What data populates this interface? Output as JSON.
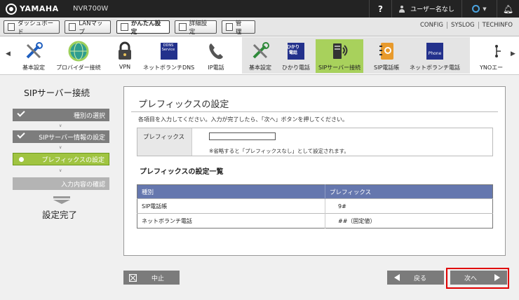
{
  "header": {
    "brand": "YAMAHA",
    "model": "NVR700W",
    "help": "?",
    "user_label": "ユーザー名なし"
  },
  "tabs": [
    {
      "label": "ダッシュボード"
    },
    {
      "label": "LANマップ"
    },
    {
      "label": "かんたん設定",
      "active": true
    },
    {
      "label": "詳細設定"
    },
    {
      "label": "管　理"
    }
  ],
  "links": [
    "CONFIG",
    "SYSLOG",
    "TECHINFO"
  ],
  "icon_bar": {
    "items": [
      {
        "label": "基本設定",
        "icon": "tools-icon"
      },
      {
        "label": "プロバイダー接続",
        "icon": "globe-icon"
      },
      {
        "label": "VPN",
        "icon": "lock-icon"
      },
      {
        "label": "ネットボランチDNS",
        "icon": "dns-icon",
        "badge": "DDNS Service"
      },
      {
        "label": "IP電話",
        "icon": "phone-icon"
      },
      {
        "label": "基本設定",
        "icon": "tools-icon"
      },
      {
        "label": "ひかり電話",
        "icon": "hikari-phone-icon",
        "badge": "ひかり 電話"
      },
      {
        "label": "SIPサーバー接続",
        "icon": "sip-server-icon",
        "current": true
      },
      {
        "label": "SIP電話帳",
        "icon": "address-book-icon"
      },
      {
        "label": "ネットボランチ電話",
        "icon": "phone-app-icon",
        "badge": "Phone"
      },
      {
        "label": "YNOエー",
        "icon": "yno-icon"
      }
    ]
  },
  "wizard": {
    "title": "SIPサーバー接続",
    "steps": [
      {
        "label": "種別の選択",
        "state": "done"
      },
      {
        "label": "SIPサーバー情報の設定",
        "state": "done"
      },
      {
        "label": "プレフィックスの設定",
        "state": "current"
      },
      {
        "label": "入力内容の確認",
        "state": "todo"
      }
    ],
    "done_label": "設定完了"
  },
  "main": {
    "title": "プレフィックスの設定",
    "instructions": "各項目を入力してください。入力が完了したら、「次へ」ボタンを押してください。",
    "prefix_field": {
      "label": "プレフィックス",
      "value": "",
      "note": "※省略すると「プレフィックスなし」として設定されます。"
    },
    "list_title": "プレフィックスの設定一覧",
    "table": {
      "columns": [
        "種別",
        "プレフィックス"
      ],
      "rows": [
        [
          "SIP電話帳",
          "9#"
        ],
        [
          "ネットボランチ電話",
          "##（固定値）"
        ]
      ]
    }
  },
  "buttons": {
    "cancel": "中止",
    "back": "戻る",
    "next": "次へ"
  },
  "colors": {
    "accent_green": "#a0c441",
    "table_header": "#6577ae",
    "highlight_frame": "#e00000"
  }
}
